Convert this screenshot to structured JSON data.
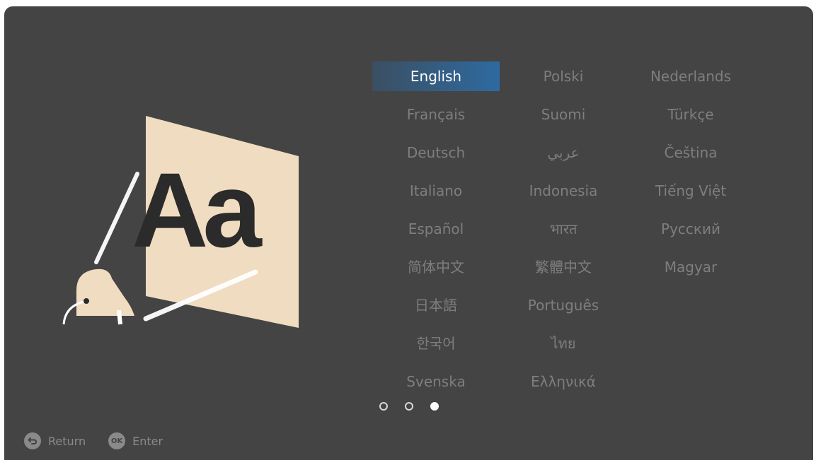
{
  "illustration": {
    "glyph_text": "Aa",
    "icon": "language-illustration"
  },
  "languages": {
    "selected": "English",
    "columns": [
      [
        "English",
        "Français",
        "Deutsch",
        "Italiano",
        "Español",
        "简体中文",
        "日本語",
        "한국어",
        "Svenska"
      ],
      [
        "Polski",
        "Suomi",
        "عربي",
        "Indonesia",
        "भारत",
        "繁體中文",
        "Português",
        "ไทย",
        "Ελληνικά"
      ],
      [
        "Nederlands",
        "Türkçe",
        "Čeština",
        "Tiếng Việt",
        "Русский",
        "Magyar"
      ]
    ]
  },
  "pagination": {
    "total": 3,
    "current": 3
  },
  "footer": {
    "return_label": "Return",
    "return_icon": "return-arrow-icon",
    "enter_label": "Enter",
    "enter_icon_text": "OK"
  },
  "colors": {
    "background": "#444444",
    "selected_start": "#3b4f62",
    "selected_end": "#2e6aa0",
    "text_inactive": "#7e7e7e",
    "text_selected": "#ffffff",
    "illustration_panel": "#f0dcc0"
  }
}
